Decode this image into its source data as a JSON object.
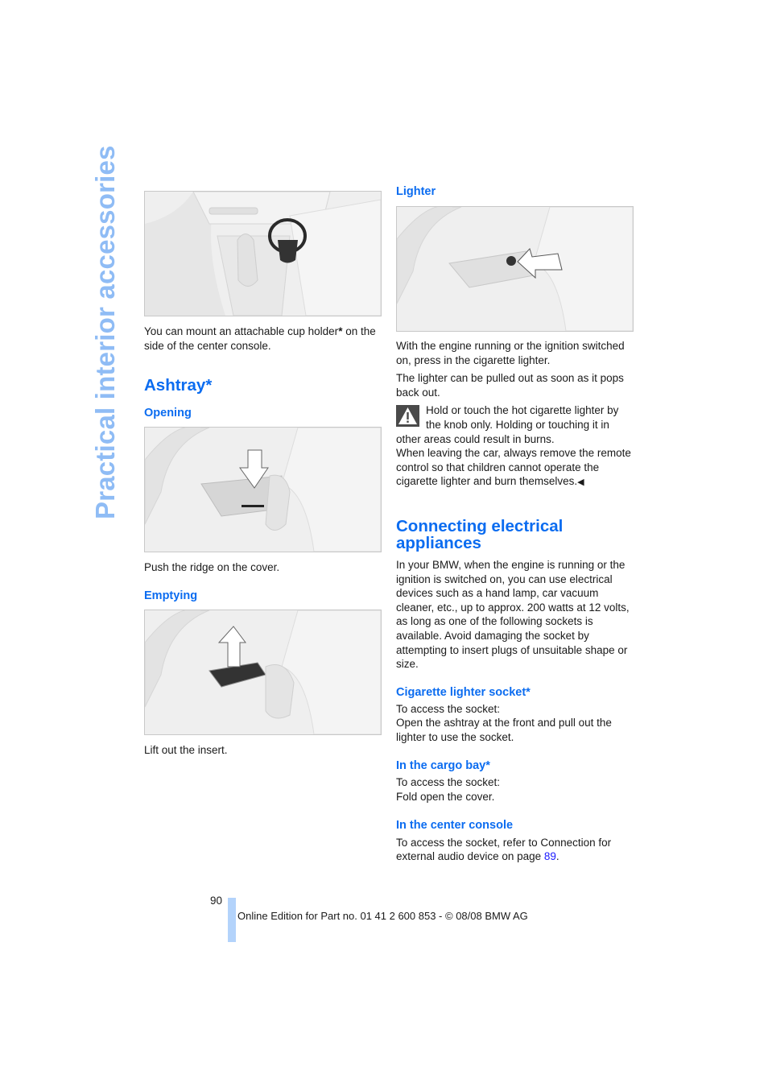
{
  "side_title": "Practical interior accessories",
  "left": {
    "cup_holder_text_before": "You can mount an attachable cup holder",
    "cup_holder_star": "*",
    "cup_holder_text_after": " on the side of the center console.",
    "ashtray_heading": "Ashtray*",
    "opening_heading": "Opening",
    "opening_text": "Push the ridge on the cover.",
    "emptying_heading": "Emptying",
    "emptying_text": "Lift out the insert."
  },
  "right": {
    "lighter_heading": "Lighter",
    "lighter_p1": "With the engine running or the ignition switched on, press in the cigarette lighter.",
    "lighter_p2": "The lighter can be pulled out as soon as it pops back out.",
    "warning_p1": "Hold or touch the hot cigarette lighter by the knob only. Holding or touching it in other areas could result in burns.",
    "warning_p2": "When leaving the car, always remove the remote control so that children cannot operate the cigarette lighter and burn themselves.",
    "end_mark": "◀",
    "connecting_heading": "Connecting electrical appliances",
    "connecting_text": "In your BMW, when the engine is running or the ignition is switched on, you can use electrical devices such as a hand lamp, car vacuum cleaner, etc., up to approx. 200 watts at 12 volts, as long as one of the following sockets is available. Avoid damaging the socket by attempting to insert plugs of unsuitable shape or size.",
    "cig_socket_heading": "Cigarette lighter socket*",
    "cig_socket_l1": "To access the socket:",
    "cig_socket_l2": "Open the ashtray at the front and pull out the lighter to use the socket.",
    "cargo_heading": "In the cargo bay*",
    "cargo_l1": "To access the socket:",
    "cargo_l2": "Fold open the cover.",
    "console_heading": "In the center console",
    "console_text": "To access the socket, refer to Connection for external audio device on page ",
    "console_link": "89",
    "console_end": "."
  },
  "footer": {
    "page_number": "90",
    "text": "Online Edition for Part no. 01 41 2 600 853 - © 08/08 BMW AG"
  }
}
